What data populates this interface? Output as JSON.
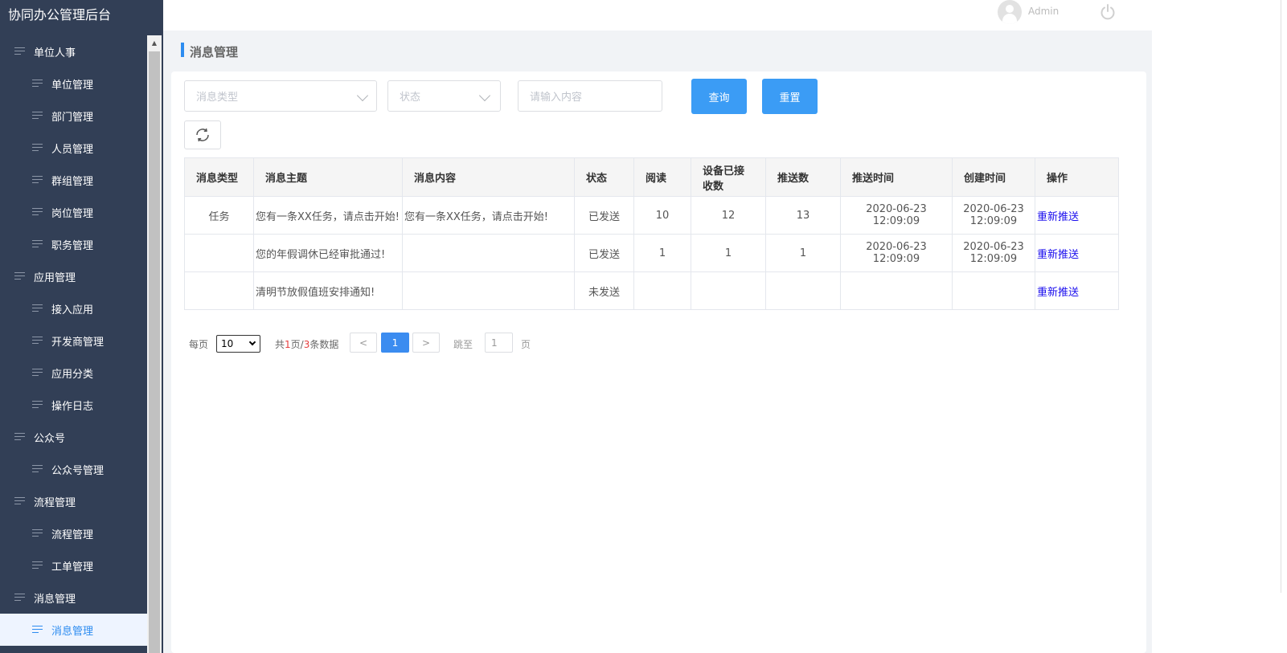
{
  "app": {
    "title": "协同办公管理后台"
  },
  "user": {
    "name": "Admin"
  },
  "sidebar": {
    "items": [
      {
        "label": "单位人事",
        "level": 1
      },
      {
        "label": "单位管理",
        "level": 2
      },
      {
        "label": "部门管理",
        "level": 2
      },
      {
        "label": "人员管理",
        "level": 2
      },
      {
        "label": "群组管理",
        "level": 2
      },
      {
        "label": "岗位管理",
        "level": 2
      },
      {
        "label": "职务管理",
        "level": 2
      },
      {
        "label": "应用管理",
        "level": 1
      },
      {
        "label": "接入应用",
        "level": 2
      },
      {
        "label": "开发商管理",
        "level": 2
      },
      {
        "label": "应用分类",
        "level": 2
      },
      {
        "label": "操作日志",
        "level": 2
      },
      {
        "label": "公众号",
        "level": 1
      },
      {
        "label": "公众号管理",
        "level": 2
      },
      {
        "label": "流程管理",
        "level": 1
      },
      {
        "label": "流程管理",
        "level": 2
      },
      {
        "label": "工单管理",
        "level": 2
      },
      {
        "label": "消息管理",
        "level": 1
      },
      {
        "label": "消息管理",
        "level": 2,
        "active": true
      }
    ]
  },
  "page": {
    "title": "消息管理"
  },
  "filters": {
    "type_placeholder": "消息类型",
    "status_placeholder": "状态",
    "content_placeholder": "请输入内容",
    "query_label": "查询",
    "reset_label": "重置"
  },
  "table": {
    "columns": [
      "消息类型",
      "消息主题",
      "消息内容",
      "状态",
      "阅读",
      "设备已接收数",
      "推送数",
      "推送时间",
      "创建时间",
      "操作"
    ],
    "rows": [
      {
        "type": "任务",
        "subject": "您有一条XX任务，请点击开始!",
        "content": "您有一条XX任务，请点击开始!",
        "status": "已发送",
        "read": "10",
        "received": "12",
        "pushed": "13",
        "push_time": "2020-06-23 12:09:09",
        "create_time": "2020-06-23 12:09:09",
        "action": "重新推送"
      },
      {
        "type": "",
        "subject": "您的年假调休已经审批通过!",
        "content": "",
        "status": "已发送",
        "read": "1",
        "received": "1",
        "pushed": "1",
        "push_time": "2020-06-23 12:09:09",
        "create_time": "2020-06-23 12:09:09",
        "action": "重新推送"
      },
      {
        "type": "",
        "subject": "清明节放假值班安排通知!",
        "content": "",
        "status": "未发送",
        "read": "",
        "received": "",
        "pushed": "",
        "push_time": "",
        "create_time": "",
        "action": "重新推送"
      }
    ]
  },
  "pagination": {
    "per_page_label": "每页",
    "per_page_value": "10",
    "total_prefix": "共",
    "total_pages": "1",
    "total_mid": "页/",
    "total_records": "3",
    "total_suffix": "条数据",
    "prev": "<",
    "current": "1",
    "next": ">",
    "jump_label": "跳至",
    "jump_value": "1",
    "page_unit": "页"
  }
}
